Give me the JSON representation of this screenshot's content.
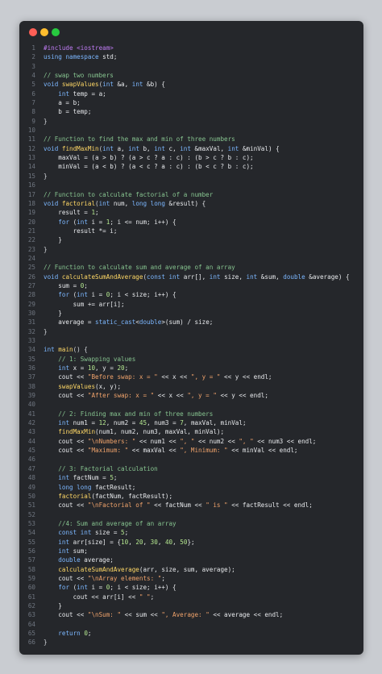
{
  "window": {
    "controls": [
      "close",
      "minimize",
      "maximize"
    ]
  },
  "colors": {
    "keyword": "#7cb7ff",
    "function": "#ffd866",
    "comment": "#86c38f",
    "string": "#f0a36b",
    "number": "#b5e890",
    "preprocessor": "#c07cf5",
    "variable": "#9fd0ff",
    "punct": "#d4d7dc",
    "plain": "#e7e9ec"
  },
  "code_lines": [
    {
      "n": "1",
      "tokens": [
        [
          "pp",
          "#include <iostream>"
        ]
      ]
    },
    {
      "n": "2",
      "tokens": [
        [
          "kw",
          "using"
        ],
        [
          "plain",
          " "
        ],
        [
          "kw",
          "namespace"
        ],
        [
          "plain",
          " std;"
        ]
      ]
    },
    {
      "n": "3",
      "tokens": []
    },
    {
      "n": "4",
      "tokens": [
        [
          "com",
          "// swap two numbers"
        ]
      ]
    },
    {
      "n": "5",
      "tokens": [
        [
          "kw",
          "void"
        ],
        [
          "plain",
          " "
        ],
        [
          "fn",
          "swapValues"
        ],
        [
          "pun",
          "("
        ],
        [
          "kw",
          "int"
        ],
        [
          "plain",
          " &a, "
        ],
        [
          "kw",
          "int"
        ],
        [
          "plain",
          " &b) {"
        ]
      ]
    },
    {
      "n": "6",
      "tokens": [
        [
          "plain",
          "    "
        ],
        [
          "kw",
          "int"
        ],
        [
          "plain",
          " temp = a;"
        ]
      ]
    },
    {
      "n": "7",
      "tokens": [
        [
          "plain",
          "    a = b;"
        ]
      ]
    },
    {
      "n": "8",
      "tokens": [
        [
          "plain",
          "    b = temp;"
        ]
      ]
    },
    {
      "n": "9",
      "tokens": [
        [
          "pun",
          "}"
        ]
      ]
    },
    {
      "n": "10",
      "tokens": []
    },
    {
      "n": "11",
      "tokens": [
        [
          "com",
          "// Function to find the max and min of three numbers"
        ]
      ]
    },
    {
      "n": "12",
      "tokens": [
        [
          "kw",
          "void"
        ],
        [
          "plain",
          " "
        ],
        [
          "fn",
          "findMaxMin"
        ],
        [
          "pun",
          "("
        ],
        [
          "kw",
          "int"
        ],
        [
          "plain",
          " a, "
        ],
        [
          "kw",
          "int"
        ],
        [
          "plain",
          " b, "
        ],
        [
          "kw",
          "int"
        ],
        [
          "plain",
          " c, "
        ],
        [
          "kw",
          "int"
        ],
        [
          "plain",
          " &maxVal, "
        ],
        [
          "kw",
          "int"
        ],
        [
          "plain",
          " &minVal) {"
        ]
      ]
    },
    {
      "n": "13",
      "tokens": [
        [
          "plain",
          "    maxVal = (a > b) ? (a > c ? a : c) : (b > c ? b : c);"
        ]
      ]
    },
    {
      "n": "14",
      "tokens": [
        [
          "plain",
          "    minVal = (a < b) ? (a < c ? a : c) : (b < c ? b : c);"
        ]
      ]
    },
    {
      "n": "15",
      "tokens": [
        [
          "pun",
          "}"
        ]
      ]
    },
    {
      "n": "16",
      "tokens": []
    },
    {
      "n": "17",
      "tokens": [
        [
          "com",
          "// Function to calculate factorial of a number"
        ]
      ]
    },
    {
      "n": "18",
      "tokens": [
        [
          "kw",
          "void"
        ],
        [
          "plain",
          " "
        ],
        [
          "fn",
          "factorial"
        ],
        [
          "pun",
          "("
        ],
        [
          "kw",
          "int"
        ],
        [
          "plain",
          " num, "
        ],
        [
          "kw",
          "long long"
        ],
        [
          "plain",
          " &result) {"
        ]
      ]
    },
    {
      "n": "19",
      "tokens": [
        [
          "plain",
          "    result = "
        ],
        [
          "num",
          "1"
        ],
        [
          "plain",
          ";"
        ]
      ]
    },
    {
      "n": "20",
      "tokens": [
        [
          "plain",
          "    "
        ],
        [
          "kw",
          "for"
        ],
        [
          "plain",
          " ("
        ],
        [
          "kw",
          "int"
        ],
        [
          "plain",
          " i = "
        ],
        [
          "num",
          "1"
        ],
        [
          "plain",
          "; i <= num; i++) {"
        ]
      ]
    },
    {
      "n": "21",
      "tokens": [
        [
          "plain",
          "        result *= i;"
        ]
      ]
    },
    {
      "n": "22",
      "tokens": [
        [
          "plain",
          "    }"
        ]
      ]
    },
    {
      "n": "23",
      "tokens": [
        [
          "pun",
          "}"
        ]
      ]
    },
    {
      "n": "24",
      "tokens": []
    },
    {
      "n": "25",
      "tokens": [
        [
          "com",
          "// Function to calculate sum and average of an array"
        ]
      ]
    },
    {
      "n": "26",
      "tokens": [
        [
          "kw",
          "void"
        ],
        [
          "plain",
          " "
        ],
        [
          "fn",
          "calculateSumAndAverage"
        ],
        [
          "pun",
          "("
        ],
        [
          "kw",
          "const int"
        ],
        [
          "plain",
          " arr[], "
        ],
        [
          "kw",
          "int"
        ],
        [
          "plain",
          " size, "
        ],
        [
          "kw",
          "int"
        ],
        [
          "plain",
          " &sum, "
        ],
        [
          "kw",
          "double"
        ],
        [
          "plain",
          " &average) {"
        ]
      ]
    },
    {
      "n": "27",
      "tokens": [
        [
          "plain",
          "    sum = "
        ],
        [
          "num",
          "0"
        ],
        [
          "plain",
          ";"
        ]
      ]
    },
    {
      "n": "28",
      "tokens": [
        [
          "plain",
          "    "
        ],
        [
          "kw",
          "for"
        ],
        [
          "plain",
          " ("
        ],
        [
          "kw",
          "int"
        ],
        [
          "plain",
          " i = "
        ],
        [
          "num",
          "0"
        ],
        [
          "plain",
          "; i < size; i++) {"
        ]
      ]
    },
    {
      "n": "29",
      "tokens": [
        [
          "plain",
          "        sum += arr[i];"
        ]
      ]
    },
    {
      "n": "30",
      "tokens": [
        [
          "plain",
          "    }"
        ]
      ]
    },
    {
      "n": "31",
      "tokens": [
        [
          "plain",
          "    average = "
        ],
        [
          "kw",
          "static_cast"
        ],
        [
          "plain",
          "<"
        ],
        [
          "kw",
          "double"
        ],
        [
          "plain",
          ">(sum) / size;"
        ]
      ]
    },
    {
      "n": "32",
      "tokens": [
        [
          "pun",
          "}"
        ]
      ]
    },
    {
      "n": "33",
      "tokens": []
    },
    {
      "n": "34",
      "tokens": [
        [
          "kw",
          "int"
        ],
        [
          "plain",
          " "
        ],
        [
          "fn",
          "main"
        ],
        [
          "pun",
          "() {"
        ]
      ]
    },
    {
      "n": "35",
      "tokens": [
        [
          "plain",
          "    "
        ],
        [
          "com",
          "// 1: Swapping values"
        ]
      ]
    },
    {
      "n": "36",
      "tokens": [
        [
          "plain",
          "    "
        ],
        [
          "kw",
          "int"
        ],
        [
          "plain",
          " x = "
        ],
        [
          "num",
          "10"
        ],
        [
          "plain",
          ", y = "
        ],
        [
          "num",
          "20"
        ],
        [
          "plain",
          ";"
        ]
      ]
    },
    {
      "n": "37",
      "tokens": [
        [
          "plain",
          "    cout << "
        ],
        [
          "str",
          "\"Before swap: x = \""
        ],
        [
          "plain",
          " << x << "
        ],
        [
          "str",
          "\", y = \""
        ],
        [
          "plain",
          " << y << endl;"
        ]
      ]
    },
    {
      "n": "38",
      "tokens": [
        [
          "plain",
          "    "
        ],
        [
          "fn",
          "swapValues"
        ],
        [
          "plain",
          "(x, y);"
        ]
      ]
    },
    {
      "n": "39",
      "tokens": [
        [
          "plain",
          "    cout << "
        ],
        [
          "str",
          "\"After swap: x = \""
        ],
        [
          "plain",
          " << x << "
        ],
        [
          "str",
          "\", y = \""
        ],
        [
          "plain",
          " << y << endl;"
        ]
      ]
    },
    {
      "n": "40",
      "tokens": []
    },
    {
      "n": "41",
      "tokens": [
        [
          "plain",
          "    "
        ],
        [
          "com",
          "// 2: Finding max and min of three numbers"
        ]
      ]
    },
    {
      "n": "42",
      "tokens": [
        [
          "plain",
          "    "
        ],
        [
          "kw",
          "int"
        ],
        [
          "plain",
          " num1 = "
        ],
        [
          "num",
          "12"
        ],
        [
          "plain",
          ", num2 = "
        ],
        [
          "num",
          "45"
        ],
        [
          "plain",
          ", num3 = "
        ],
        [
          "num",
          "7"
        ],
        [
          "plain",
          ", maxVal, minVal;"
        ]
      ]
    },
    {
      "n": "43",
      "tokens": [
        [
          "plain",
          "    "
        ],
        [
          "fn",
          "findMaxMin"
        ],
        [
          "plain",
          "(num1, num2, num3, maxVal, minVal);"
        ]
      ]
    },
    {
      "n": "44",
      "tokens": [
        [
          "plain",
          "    cout << "
        ],
        [
          "str",
          "\"\\nNumbers: \""
        ],
        [
          "plain",
          " << num1 << "
        ],
        [
          "str",
          "\", \""
        ],
        [
          "plain",
          " << num2 << "
        ],
        [
          "str",
          "\", \""
        ],
        [
          "plain",
          " << num3 << endl;"
        ]
      ]
    },
    {
      "n": "45",
      "tokens": [
        [
          "plain",
          "    cout << "
        ],
        [
          "str",
          "\"Maximum: \""
        ],
        [
          "plain",
          " << maxVal << "
        ],
        [
          "str",
          "\", Minimum: \""
        ],
        [
          "plain",
          " << minVal << endl;"
        ]
      ]
    },
    {
      "n": "46",
      "tokens": []
    },
    {
      "n": "47",
      "tokens": [
        [
          "plain",
          "    "
        ],
        [
          "com",
          "// 3: Factorial calculation"
        ]
      ]
    },
    {
      "n": "48",
      "tokens": [
        [
          "plain",
          "    "
        ],
        [
          "kw",
          "int"
        ],
        [
          "plain",
          " factNum = "
        ],
        [
          "num",
          "5"
        ],
        [
          "plain",
          ";"
        ]
      ]
    },
    {
      "n": "49",
      "tokens": [
        [
          "plain",
          "    "
        ],
        [
          "kw",
          "long long"
        ],
        [
          "plain",
          " factResult;"
        ]
      ]
    },
    {
      "n": "50",
      "tokens": [
        [
          "plain",
          "    "
        ],
        [
          "fn",
          "factorial"
        ],
        [
          "plain",
          "(factNum, factResult);"
        ]
      ]
    },
    {
      "n": "51",
      "tokens": [
        [
          "plain",
          "    cout << "
        ],
        [
          "str",
          "\"\\nFactorial of \""
        ],
        [
          "plain",
          " << factNum << "
        ],
        [
          "str",
          "\" is \""
        ],
        [
          "plain",
          " << factResult << endl;"
        ]
      ]
    },
    {
      "n": "52",
      "tokens": []
    },
    {
      "n": "53",
      "tokens": [
        [
          "plain",
          "    "
        ],
        [
          "com",
          "//4: Sum and average of an array"
        ]
      ]
    },
    {
      "n": "54",
      "tokens": [
        [
          "plain",
          "    "
        ],
        [
          "kw",
          "const int"
        ],
        [
          "plain",
          " size = "
        ],
        [
          "num",
          "5"
        ],
        [
          "plain",
          ";"
        ]
      ]
    },
    {
      "n": "55",
      "tokens": [
        [
          "plain",
          "    "
        ],
        [
          "kw",
          "int"
        ],
        [
          "plain",
          " arr[size] = {"
        ],
        [
          "num",
          "10"
        ],
        [
          "plain",
          ", "
        ],
        [
          "num",
          "20"
        ],
        [
          "plain",
          ", "
        ],
        [
          "num",
          "30"
        ],
        [
          "plain",
          ", "
        ],
        [
          "num",
          "40"
        ],
        [
          "plain",
          ", "
        ],
        [
          "num",
          "50"
        ],
        [
          "plain",
          "};"
        ]
      ]
    },
    {
      "n": "56",
      "tokens": [
        [
          "plain",
          "    "
        ],
        [
          "kw",
          "int"
        ],
        [
          "plain",
          " sum;"
        ]
      ]
    },
    {
      "n": "57",
      "tokens": [
        [
          "plain",
          "    "
        ],
        [
          "kw",
          "double"
        ],
        [
          "plain",
          " average;"
        ]
      ]
    },
    {
      "n": "58",
      "tokens": [
        [
          "plain",
          "    "
        ],
        [
          "fn",
          "calculateSumAndAverage"
        ],
        [
          "plain",
          "(arr, size, sum, average);"
        ]
      ]
    },
    {
      "n": "59",
      "tokens": [
        [
          "plain",
          "    cout << "
        ],
        [
          "str",
          "\"\\nArray elements: \""
        ],
        [
          "plain",
          ";"
        ]
      ]
    },
    {
      "n": "60",
      "tokens": [
        [
          "plain",
          "    "
        ],
        [
          "kw",
          "for"
        ],
        [
          "plain",
          " ("
        ],
        [
          "kw",
          "int"
        ],
        [
          "plain",
          " i = "
        ],
        [
          "num",
          "0"
        ],
        [
          "plain",
          "; i < size; i++) {"
        ]
      ]
    },
    {
      "n": "61",
      "tokens": [
        [
          "plain",
          "        cout << arr[i] << "
        ],
        [
          "str",
          "\" \""
        ],
        [
          "plain",
          ";"
        ]
      ]
    },
    {
      "n": "62",
      "tokens": [
        [
          "plain",
          "    }"
        ]
      ]
    },
    {
      "n": "63",
      "tokens": [
        [
          "plain",
          "    cout << "
        ],
        [
          "str",
          "\"\\nSum: \""
        ],
        [
          "plain",
          " << sum << "
        ],
        [
          "str",
          "\", Average: \""
        ],
        [
          "plain",
          " << average << endl;"
        ]
      ]
    },
    {
      "n": "64",
      "tokens": []
    },
    {
      "n": "65",
      "tokens": [
        [
          "plain",
          "    "
        ],
        [
          "kw",
          "return"
        ],
        [
          "plain",
          " "
        ],
        [
          "num",
          "0"
        ],
        [
          "plain",
          ";"
        ]
      ]
    },
    {
      "n": "66",
      "tokens": [
        [
          "pun",
          "}"
        ]
      ]
    }
  ]
}
